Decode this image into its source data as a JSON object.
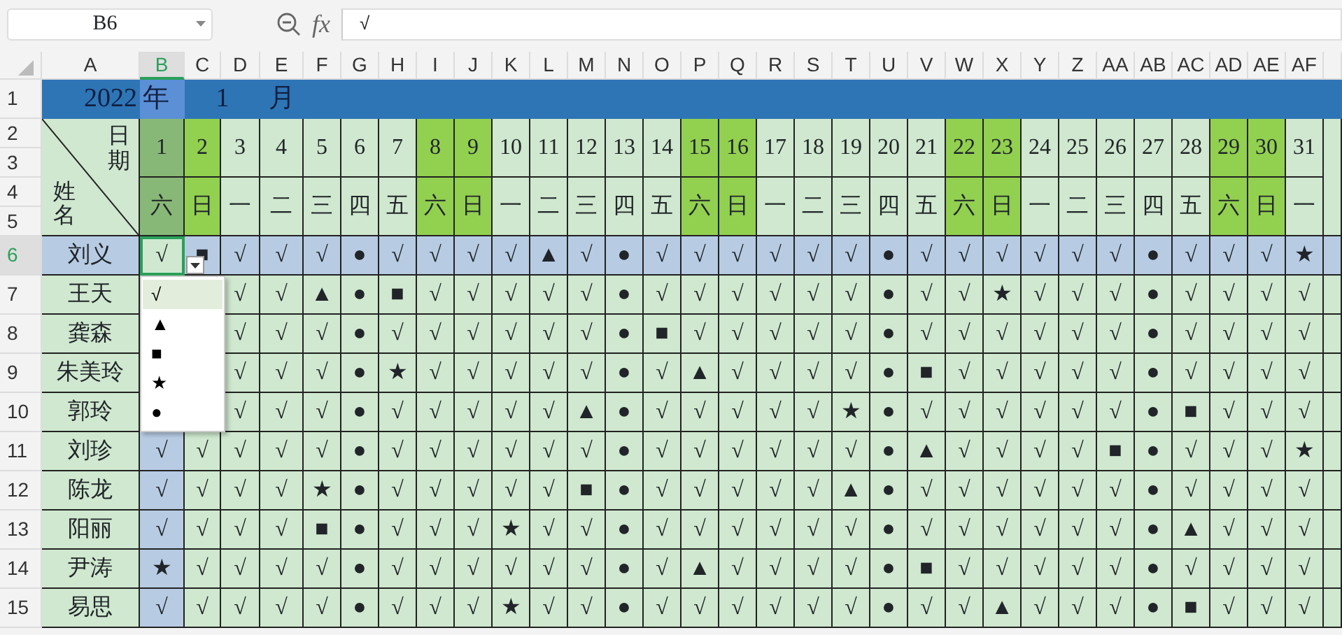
{
  "name_box": {
    "value": "B6"
  },
  "formula_bar": {
    "label": "fx",
    "value": "√"
  },
  "column_headers": [
    {
      "label": "A",
      "selected": false
    },
    {
      "label": "B",
      "selected": true
    },
    {
      "label": "C",
      "selected": false
    },
    {
      "label": "D",
      "selected": false
    },
    {
      "label": "E",
      "selected": false
    },
    {
      "label": "F",
      "selected": false
    },
    {
      "label": "G",
      "selected": false
    },
    {
      "label": "H",
      "selected": false
    },
    {
      "label": "I",
      "selected": false
    },
    {
      "label": "J",
      "selected": false
    },
    {
      "label": "K",
      "selected": false
    },
    {
      "label": "L",
      "selected": false
    },
    {
      "label": "M",
      "selected": false
    },
    {
      "label": "N",
      "selected": false
    },
    {
      "label": "O",
      "selected": false
    },
    {
      "label": "P",
      "selected": false
    },
    {
      "label": "Q",
      "selected": false
    },
    {
      "label": "R",
      "selected": false
    },
    {
      "label": "S",
      "selected": false
    },
    {
      "label": "T",
      "selected": false
    },
    {
      "label": "U",
      "selected": false
    },
    {
      "label": "V",
      "selected": false
    },
    {
      "label": "W",
      "selected": false
    },
    {
      "label": "X",
      "selected": false
    },
    {
      "label": "Y",
      "selected": false
    },
    {
      "label": "Z",
      "selected": false
    },
    {
      "label": "AA",
      "selected": false
    },
    {
      "label": "AB",
      "selected": false
    },
    {
      "label": "AC",
      "selected": false
    },
    {
      "label": "AD",
      "selected": false
    },
    {
      "label": "AE",
      "selected": false
    },
    {
      "label": "AF",
      "selected": false
    }
  ],
  "header_row_numbers": [
    "1",
    "2",
    "3",
    "4",
    "5"
  ],
  "title_row": {
    "year": "2022",
    "year_unit": "年",
    "month": "1",
    "month_unit": "月"
  },
  "header": {
    "date_label": "日期",
    "name_label": "姓名",
    "days": [
      {
        "day": "1",
        "weekday": "六",
        "weekend": true
      },
      {
        "day": "2",
        "weekday": "日",
        "weekend": true
      },
      {
        "day": "3",
        "weekday": "一",
        "weekend": false
      },
      {
        "day": "4",
        "weekday": "二",
        "weekend": false
      },
      {
        "day": "5",
        "weekday": "三",
        "weekend": false
      },
      {
        "day": "6",
        "weekday": "四",
        "weekend": false
      },
      {
        "day": "7",
        "weekday": "五",
        "weekend": false
      },
      {
        "day": "8",
        "weekday": "六",
        "weekend": true
      },
      {
        "day": "9",
        "weekday": "日",
        "weekend": true
      },
      {
        "day": "10",
        "weekday": "一",
        "weekend": false
      },
      {
        "day": "11",
        "weekday": "二",
        "weekend": false
      },
      {
        "day": "12",
        "weekday": "三",
        "weekend": false
      },
      {
        "day": "13",
        "weekday": "四",
        "weekend": false
      },
      {
        "day": "14",
        "weekday": "五",
        "weekend": false
      },
      {
        "day": "15",
        "weekday": "六",
        "weekend": true
      },
      {
        "day": "16",
        "weekday": "日",
        "weekend": true
      },
      {
        "day": "17",
        "weekday": "一",
        "weekend": false
      },
      {
        "day": "18",
        "weekday": "二",
        "weekend": false
      },
      {
        "day": "19",
        "weekday": "三",
        "weekend": false
      },
      {
        "day": "20",
        "weekday": "四",
        "weekend": false
      },
      {
        "day": "21",
        "weekday": "五",
        "weekend": false
      },
      {
        "day": "22",
        "weekday": "六",
        "weekend": true
      },
      {
        "day": "23",
        "weekday": "日",
        "weekend": true
      },
      {
        "day": "24",
        "weekday": "一",
        "weekend": false
      },
      {
        "day": "25",
        "weekday": "二",
        "weekend": false
      },
      {
        "day": "26",
        "weekday": "三",
        "weekend": false
      },
      {
        "day": "27",
        "weekday": "四",
        "weekend": false
      },
      {
        "day": "28",
        "weekday": "五",
        "weekend": false
      },
      {
        "day": "29",
        "weekday": "六",
        "weekend": true
      },
      {
        "day": "30",
        "weekday": "日",
        "weekend": true
      },
      {
        "day": "31",
        "weekday": "一",
        "weekend": false
      }
    ]
  },
  "rows": [
    {
      "number": "6",
      "name": "刘义",
      "selected": true,
      "cells": [
        "√",
        "■",
        "√",
        "√",
        "√",
        "●",
        "√",
        "√",
        "√",
        "√",
        "▲",
        "√",
        "●",
        "√",
        "√",
        "√",
        "√",
        "√",
        "√",
        "●",
        "√",
        "√",
        "√",
        "√",
        "√",
        "√",
        "●",
        "√",
        "√",
        "√",
        "★"
      ]
    },
    {
      "number": "7",
      "name": "王天",
      "selected": false,
      "cells": [
        null,
        null,
        "√",
        "√",
        "▲",
        "●",
        "■",
        "√",
        "√",
        "√",
        "√",
        "√",
        "●",
        "√",
        "√",
        "√",
        "√",
        "√",
        "√",
        "●",
        "√",
        "√",
        "★",
        "√",
        "√",
        "√",
        "●",
        "√",
        "√",
        "√",
        "√"
      ]
    },
    {
      "number": "8",
      "name": "龚森",
      "selected": false,
      "cells": [
        null,
        null,
        "√",
        "√",
        "√",
        "●",
        "√",
        "√",
        "√",
        "√",
        "√",
        "√",
        "●",
        "■",
        "√",
        "√",
        "√",
        "√",
        "√",
        "●",
        "√",
        "√",
        "√",
        "√",
        "√",
        "√",
        "●",
        "√",
        "√",
        "√",
        "√"
      ]
    },
    {
      "number": "9",
      "name": "朱美玲",
      "selected": false,
      "cells": [
        null,
        null,
        "√",
        "√",
        "√",
        "●",
        "★",
        "√",
        "√",
        "√",
        "√",
        "√",
        "●",
        "√",
        "▲",
        "√",
        "√",
        "√",
        "√",
        "●",
        "■",
        "√",
        "√",
        "√",
        "√",
        "√",
        "●",
        "√",
        "√",
        "√",
        "√"
      ]
    },
    {
      "number": "10",
      "name": "郭玲",
      "selected": false,
      "cells": [
        null,
        null,
        "√",
        "√",
        "√",
        "●",
        "√",
        "√",
        "√",
        "√",
        "√",
        "▲",
        "●",
        "√",
        "√",
        "√",
        "√",
        "√",
        "★",
        "●",
        "√",
        "√",
        "√",
        "√",
        "√",
        "√",
        "●",
        "■",
        "√",
        "√",
        "√"
      ]
    },
    {
      "number": "11",
      "name": "刘珍",
      "selected": false,
      "cells": [
        "√",
        "√",
        "√",
        "√",
        "√",
        "●",
        "√",
        "√",
        "√",
        "√",
        "√",
        "√",
        "●",
        "√",
        "√",
        "√",
        "√",
        "√",
        "√",
        "●",
        "▲",
        "√",
        "√",
        "√",
        "√",
        "■",
        "●",
        "√",
        "√",
        "√",
        "★"
      ]
    },
    {
      "number": "12",
      "name": "陈龙",
      "selected": false,
      "cells": [
        "√",
        "√",
        "√",
        "√",
        "★",
        "●",
        "√",
        "√",
        "√",
        "√",
        "√",
        "■",
        "●",
        "√",
        "√",
        "√",
        "√",
        "√",
        "▲",
        "●",
        "√",
        "√",
        "√",
        "√",
        "√",
        "√",
        "●",
        "√",
        "√",
        "√",
        "√"
      ]
    },
    {
      "number": "13",
      "name": "阳丽",
      "selected": false,
      "cells": [
        "√",
        "√",
        "√",
        "√",
        "■",
        "●",
        "√",
        "√",
        "√",
        "★",
        "√",
        "√",
        "●",
        "√",
        "√",
        "√",
        "√",
        "√",
        "√",
        "●",
        "√",
        "√",
        "√",
        "√",
        "√",
        "√",
        "●",
        "▲",
        "√",
        "√",
        "√"
      ]
    },
    {
      "number": "14",
      "name": "尹涛",
      "selected": false,
      "cells": [
        "★",
        "√",
        "√",
        "√",
        "√",
        "●",
        "√",
        "√",
        "√",
        "√",
        "√",
        "√",
        "●",
        "√",
        "▲",
        "√",
        "√",
        "√",
        "√",
        "●",
        "■",
        "√",
        "√",
        "√",
        "√",
        "√",
        "●",
        "√",
        "√",
        "√",
        "√"
      ]
    },
    {
      "number": "15",
      "name": "易思",
      "selected": false,
      "cells": [
        "√",
        "√",
        "√",
        "√",
        "√",
        "●",
        "√",
        "√",
        "√",
        "★",
        "√",
        "√",
        "●",
        "√",
        "√",
        "√",
        "√",
        "√",
        "√",
        "●",
        "√",
        "√",
        "▲",
        "√",
        "√",
        "√",
        "●",
        "■",
        "√",
        "√",
        "√"
      ]
    }
  ],
  "dropdown": {
    "options": [
      {
        "label": "√",
        "selected": true
      },
      {
        "label": "▲",
        "selected": false
      },
      {
        "label": "■",
        "selected": false
      },
      {
        "label": "★",
        "selected": false
      },
      {
        "label": "●",
        "selected": false
      }
    ]
  }
}
